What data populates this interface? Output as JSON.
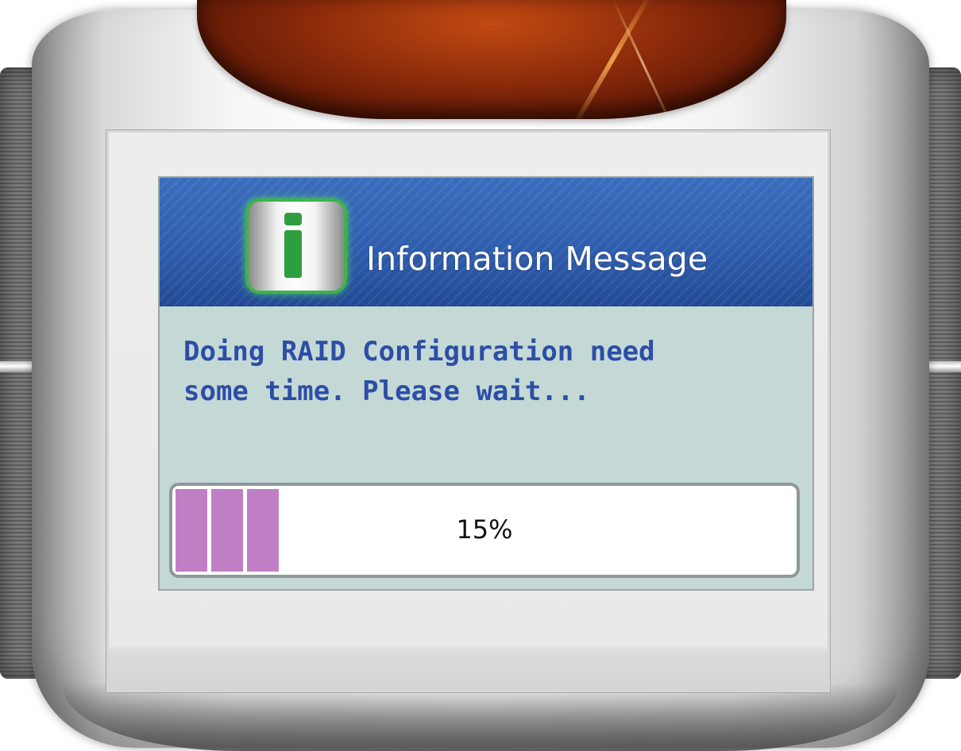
{
  "dialog": {
    "title": "Information Message",
    "icon": "info-icon",
    "message_line1": "Doing RAID Configuration need",
    "message_line2": "some time. Please wait..."
  },
  "progress": {
    "percent": 15,
    "label": "15%",
    "fill_color": "#c07fc4",
    "filled_blocks": 3
  },
  "colors": {
    "header_blue": "#2f5eae",
    "dialog_background": "#c4d9d5",
    "message_text": "#2d4ea7",
    "dome": "#8a2a0a"
  }
}
